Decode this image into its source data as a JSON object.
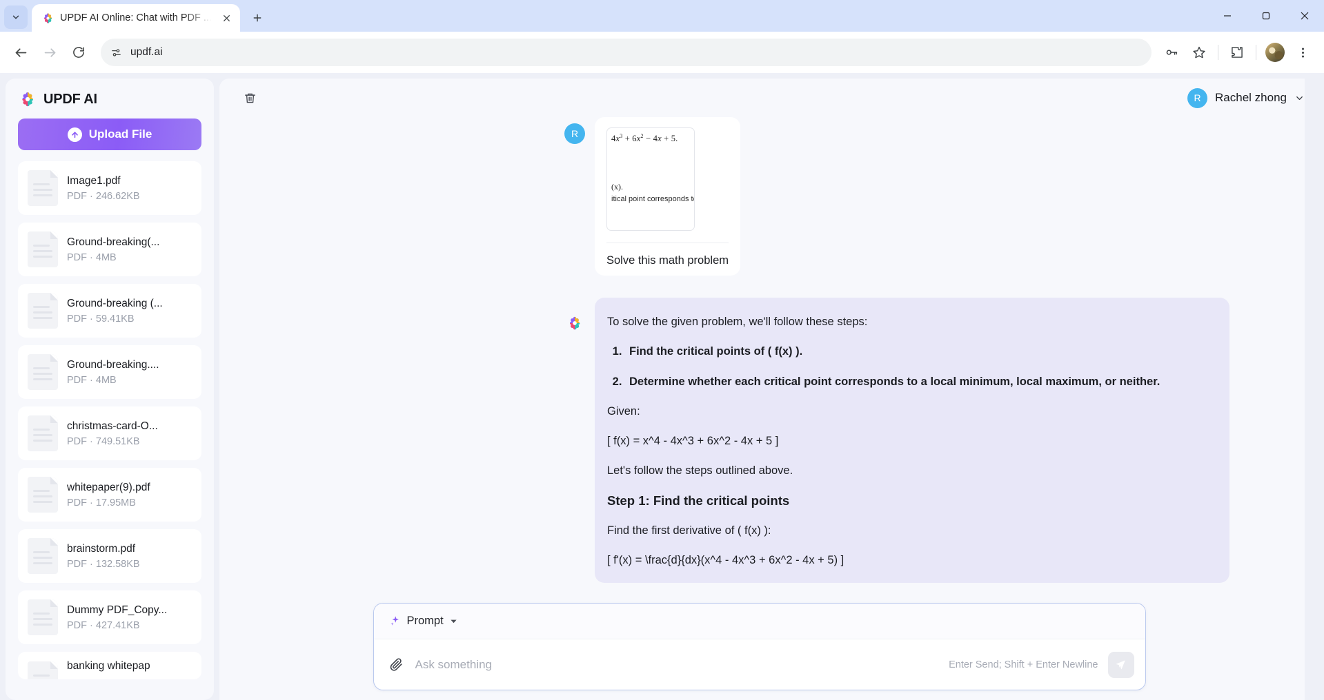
{
  "browser": {
    "tab": {
      "title": "UPDF AI Online: Chat with PDF ...",
      "favicon": "updf-logo-icon",
      "close": "close-tab-icon"
    },
    "new_tab_label": "+",
    "omnibox": {
      "url": "updf.ai",
      "site_info_icon": "site-settings-icon"
    },
    "nav": {
      "back": "back-arrow-icon",
      "forward": "forward-arrow-icon",
      "reload": "reload-icon"
    },
    "toolbar_icons": [
      "password-key-icon",
      "bookmark-star-icon",
      "extensions-puzzle-icon",
      "profile-avatar",
      "chrome-menu-icon"
    ],
    "window_controls": [
      "minimize",
      "maximize",
      "close"
    ]
  },
  "sidebar": {
    "brand": "UPDF AI",
    "upload_button": "Upload File",
    "files": [
      {
        "name": "Image1.pdf",
        "meta": "PDF · 246.62KB"
      },
      {
        "name": "Ground-breaking(...",
        "meta": "PDF · 4MB"
      },
      {
        "name": "Ground-breaking (...",
        "meta": "PDF · 59.41KB"
      },
      {
        "name": "Ground-breaking....",
        "meta": "PDF · 4MB"
      },
      {
        "name": "christmas-card-O...",
        "meta": "PDF · 749.51KB"
      },
      {
        "name": "whitepaper(9).pdf",
        "meta": "PDF · 17.95MB"
      },
      {
        "name": "brainstorm.pdf",
        "meta": "PDF · 132.58KB"
      },
      {
        "name": "Dummy PDF_Copy...",
        "meta": "PDF · 427.41KB"
      },
      {
        "name": "banking whitepap",
        "meta": ""
      }
    ]
  },
  "header": {
    "delete_icon": "trash-icon",
    "account_name": "Rachel zhong",
    "account_initial": "R",
    "chevron": "chevron-down-icon"
  },
  "chat": {
    "user_message": {
      "avatar_initial": "R",
      "thumbnail": {
        "line1": "4x3 + 6x2 − 4x + 5.",
        "line2": "(x).",
        "line3": "itical point corresponds to"
      },
      "caption": "Solve this math problem"
    },
    "ai_message": {
      "avatar": "updf-logo-icon",
      "intro": "To solve the given problem, we'll follow these steps:",
      "steps": [
        "Find the critical points of ( f(x) ).",
        "Determine whether each critical point corresponds to a local minimum, local maximum, or neither."
      ],
      "given_label": "Given:",
      "given_formula": "[ f(x) = x^4 - 4x^3 + 6x^2 - 4x + 5 ]",
      "follow": "Let's follow the steps outlined above.",
      "step_heading": "Step 1: Find the critical points",
      "derivative_text": "Find the first derivative of ( f(x) ):",
      "derivative_formula": "[ f'(x) = \\frac{d}{dx}(x^4 - 4x^3 + 6x^2 - 4x + 5) ]"
    }
  },
  "composer": {
    "prompt_label": "Prompt",
    "prompt_icon": "sparkle-icon",
    "chevron": "chevron-down-icon",
    "attach_icon": "paperclip-icon",
    "input_value": "",
    "input_placeholder": "Ask something",
    "hint": "Enter Send; Shift + Enter Newline",
    "send_icon": "send-icon"
  },
  "colors": {
    "accent_purple": "#8b5cf6",
    "ai_bubble": "#e8e7f8",
    "avatar_blue": "#44b5ef",
    "page_bg": "#eef0f7",
    "panel_bg": "#f7f8fc",
    "composer_border": "#b9c8ee"
  }
}
